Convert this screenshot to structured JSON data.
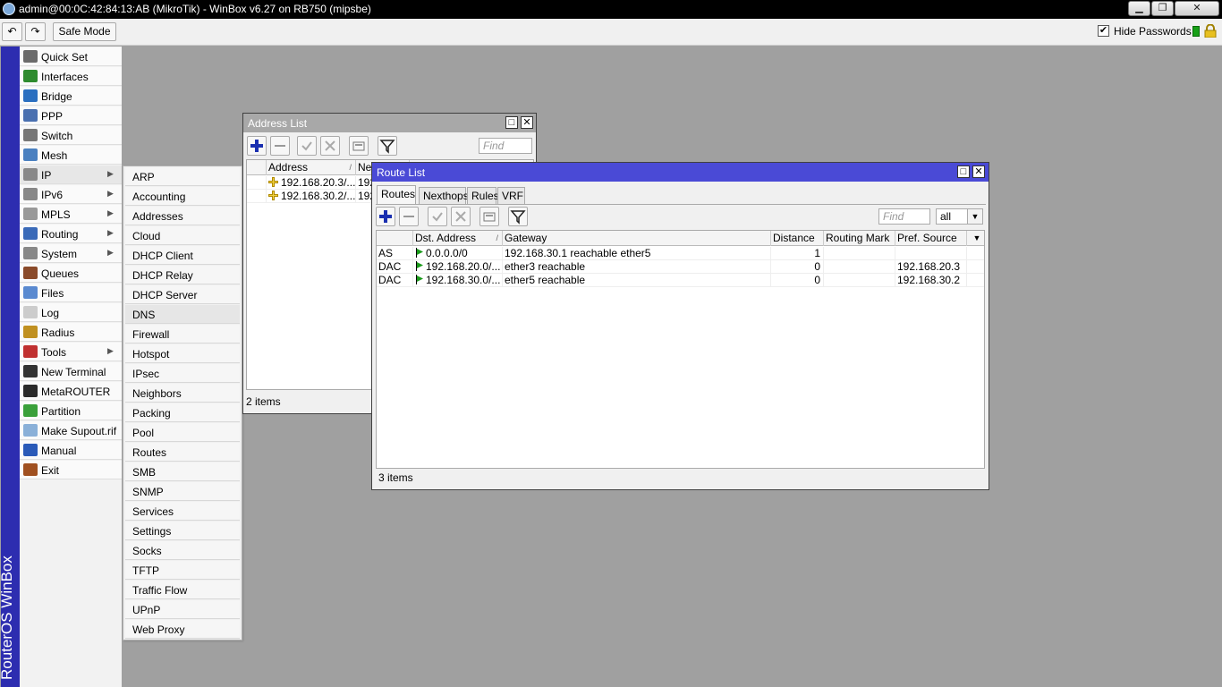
{
  "window": {
    "title": "admin@00:0C:42:84:13:AB (MikroTik) - WinBox v6.27 on RB750 (mipsbe)",
    "min_label": "▁",
    "max_label": "❐",
    "close_label": "✕"
  },
  "toolbar": {
    "undo": "↶",
    "redo": "↷",
    "safe_mode": "Safe Mode",
    "hide_passwords": "Hide Passwords",
    "hide_passwords_checked": "✔"
  },
  "brand": "RouterOS WinBox",
  "menu": {
    "items": [
      {
        "label": "Quick Set",
        "icon": "quick-set-icon"
      },
      {
        "label": "Interfaces",
        "icon": "interfaces-icon"
      },
      {
        "label": "Bridge",
        "icon": "bridge-icon"
      },
      {
        "label": "PPP",
        "icon": "ppp-icon"
      },
      {
        "label": "Switch",
        "icon": "switch-icon"
      },
      {
        "label": "Mesh",
        "icon": "mesh-icon"
      },
      {
        "label": "IP",
        "icon": "ip-icon",
        "arrow": "▶"
      },
      {
        "label": "IPv6",
        "icon": "ipv6-icon",
        "arrow": "▶"
      },
      {
        "label": "MPLS",
        "icon": "mpls-icon",
        "arrow": "▶"
      },
      {
        "label": "Routing",
        "icon": "routing-icon",
        "arrow": "▶"
      },
      {
        "label": "System",
        "icon": "system-icon",
        "arrow": "▶"
      },
      {
        "label": "Queues",
        "icon": "queues-icon"
      },
      {
        "label": "Files",
        "icon": "files-icon"
      },
      {
        "label": "Log",
        "icon": "log-icon"
      },
      {
        "label": "Radius",
        "icon": "radius-icon"
      },
      {
        "label": "Tools",
        "icon": "tools-icon",
        "arrow": "▶"
      },
      {
        "label": "New Terminal",
        "icon": "terminal-icon"
      },
      {
        "label": "MetaROUTER",
        "icon": "metarouter-icon"
      },
      {
        "label": "Partition",
        "icon": "partition-icon"
      },
      {
        "label": "Make Supout.rif",
        "icon": "supout-icon"
      },
      {
        "label": "Manual",
        "icon": "manual-icon"
      },
      {
        "label": "Exit",
        "icon": "exit-icon"
      }
    ]
  },
  "submenu": {
    "items": [
      "ARP",
      "Accounting",
      "Addresses",
      "Cloud",
      "DHCP Client",
      "DHCP Relay",
      "DHCP Server",
      "DNS",
      "Firewall",
      "Hotspot",
      "IPsec",
      "Neighbors",
      "Packing",
      "Pool",
      "Routes",
      "SMB",
      "SNMP",
      "Services",
      "Settings",
      "Socks",
      "TFTP",
      "Traffic Flow",
      "UPnP",
      "Web Proxy"
    ]
  },
  "address_list": {
    "title": "Address List",
    "find_placeholder": "Find",
    "col_address": "Address",
    "col_network": "Net",
    "sort_mark": "/",
    "rows": [
      {
        "address": "192.168.20.3/...",
        "network": "192"
      },
      {
        "address": "192.168.30.2/...",
        "network": "192"
      }
    ],
    "status": "2 items"
  },
  "route_list": {
    "title": "Route List",
    "tabs": [
      "Routes",
      "Nexthops",
      "Rules",
      "VRF"
    ],
    "find_placeholder": "Find",
    "filter_value": "all",
    "columns": [
      "",
      "Dst. Address",
      "Gateway",
      "Distance",
      "Routing Mark",
      "Pref. Source"
    ],
    "sort_mark": "/",
    "rows": [
      {
        "flags": "AS",
        "dst": "0.0.0.0/0",
        "gateway": "192.168.30.1 reachable ether5",
        "distance": "1",
        "mark": "",
        "pref": ""
      },
      {
        "flags": "DAC",
        "dst": "192.168.20.0/...",
        "gateway": "ether3 reachable",
        "distance": "0",
        "mark": "",
        "pref": "192.168.20.3"
      },
      {
        "flags": "DAC",
        "dst": "192.168.30.0/...",
        "gateway": "ether5 reachable",
        "distance": "0",
        "mark": "",
        "pref": "192.168.30.2"
      }
    ],
    "status": "3 items"
  },
  "colors": {
    "route_title_bg": "#4a4ad6",
    "address_title_bg": "#a8a8a8",
    "brand_bg": "#2d2db0",
    "desktop": "#a0a0a0"
  }
}
